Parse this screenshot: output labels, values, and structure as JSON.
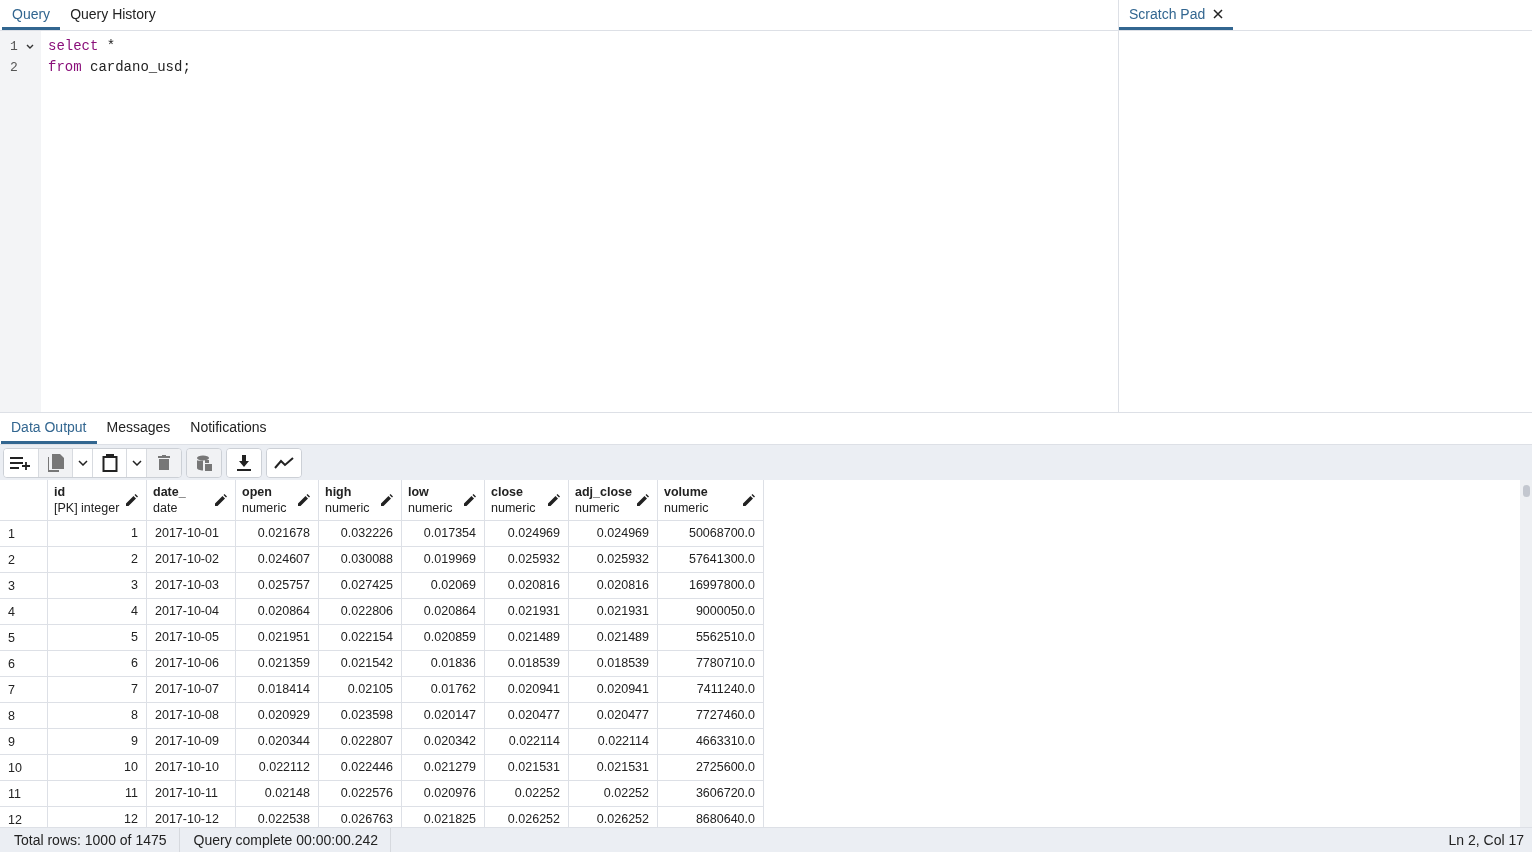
{
  "query_tabs": [
    {
      "label": "Query",
      "selected": true
    },
    {
      "label": "Query History",
      "selected": false
    }
  ],
  "scratch_tabs": [
    {
      "label": "Scratch Pad",
      "selected": true
    }
  ],
  "editor": {
    "lines": [
      {
        "number": "1",
        "expanded": true,
        "tokens": [
          {
            "kind": "keyword",
            "text": "select"
          },
          {
            "kind": "plain",
            "text": " *"
          }
        ]
      },
      {
        "number": "2",
        "tokens": [
          {
            "kind": "keyword",
            "text": "from"
          },
          {
            "kind": "plain",
            "text": " cardano_usd;"
          }
        ]
      }
    ]
  },
  "result_tabs": [
    {
      "label": "Data Output",
      "selected": true
    },
    {
      "label": "Messages",
      "selected": false
    },
    {
      "label": "Notifications",
      "selected": false
    }
  ],
  "toolbar": [
    {
      "disabled": false
    },
    {
      "disabled": true
    },
    {
      "disabled": false
    },
    {
      "disabled": false
    },
    {
      "disabled": false
    },
    {
      "disabled": true
    },
    {
      "disabled": true
    },
    {
      "disabled": false
    },
    {
      "disabled": false
    }
  ],
  "table": {
    "columns": [
      {
        "name": "id",
        "type": "[PK] integer"
      },
      {
        "name": "date_",
        "type": "date"
      },
      {
        "name": "open",
        "type": "numeric"
      },
      {
        "name": "high",
        "type": "numeric"
      },
      {
        "name": "low",
        "type": "numeric"
      },
      {
        "name": "close",
        "type": "numeric"
      },
      {
        "name": "adj_close",
        "type": "numeric"
      },
      {
        "name": "volume",
        "type": "numeric"
      }
    ],
    "rows": [
      {
        "row_number": "1",
        "cells": [
          "1",
          "2017-10-01",
          "0.021678",
          "0.032226",
          "0.017354",
          "0.024969",
          "0.024969",
          "50068700.0"
        ]
      },
      {
        "row_number": "2",
        "cells": [
          "2",
          "2017-10-02",
          "0.024607",
          "0.030088",
          "0.019969",
          "0.025932",
          "0.025932",
          "57641300.0"
        ]
      },
      {
        "row_number": "3",
        "cells": [
          "3",
          "2017-10-03",
          "0.025757",
          "0.027425",
          "0.02069",
          "0.020816",
          "0.020816",
          "16997800.0"
        ]
      },
      {
        "row_number": "4",
        "cells": [
          "4",
          "2017-10-04",
          "0.020864",
          "0.022806",
          "0.020864",
          "0.021931",
          "0.021931",
          "9000050.0"
        ]
      },
      {
        "row_number": "5",
        "cells": [
          "5",
          "2017-10-05",
          "0.021951",
          "0.022154",
          "0.020859",
          "0.021489",
          "0.021489",
          "5562510.0"
        ]
      },
      {
        "row_number": "6",
        "cells": [
          "6",
          "2017-10-06",
          "0.021359",
          "0.021542",
          "0.01836",
          "0.018539",
          "0.018539",
          "7780710.0"
        ]
      },
      {
        "row_number": "7",
        "cells": [
          "7",
          "2017-10-07",
          "0.018414",
          "0.02105",
          "0.01762",
          "0.020941",
          "0.020941",
          "7411240.0"
        ]
      },
      {
        "row_number": "8",
        "cells": [
          "8",
          "2017-10-08",
          "0.020929",
          "0.023598",
          "0.020147",
          "0.020477",
          "0.020477",
          "7727460.0"
        ]
      },
      {
        "row_number": "9",
        "cells": [
          "9",
          "2017-10-09",
          "0.020344",
          "0.022807",
          "0.020342",
          "0.022114",
          "0.022114",
          "4663310.0"
        ]
      },
      {
        "row_number": "10",
        "cells": [
          "10",
          "2017-10-10",
          "0.022112",
          "0.022446",
          "0.021279",
          "0.021531",
          "0.021531",
          "2725600.0"
        ]
      },
      {
        "row_number": "11",
        "cells": [
          "11",
          "2017-10-11",
          "0.02148",
          "0.022576",
          "0.020976",
          "0.02252",
          "0.02252",
          "3606720.0"
        ]
      },
      {
        "row_number": "12",
        "cells": [
          "12",
          "2017-10-12",
          "0.022538",
          "0.026763",
          "0.021825",
          "0.026252",
          "0.026252",
          "8680640.0"
        ]
      }
    ]
  },
  "status_bar": {
    "total_rows": "Total rows: 1000 of 1475",
    "query_status": "Query complete 00:00:00.242",
    "cursor": "Ln 2, Col 17"
  }
}
